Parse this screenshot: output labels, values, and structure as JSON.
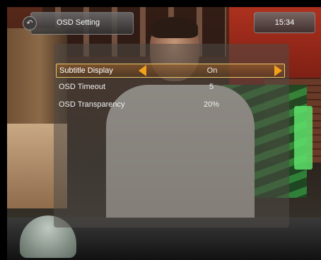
{
  "osd": {
    "title": "OSD Setting",
    "menu_icon": "back-icon",
    "clock": "15:34",
    "items": [
      {
        "label": "Subtitle Display",
        "value": "On",
        "selected": true
      },
      {
        "label": "OSD Timeout",
        "value": "5",
        "selected": false
      },
      {
        "label": "OSD Transparency",
        "value": "20%",
        "selected": false
      }
    ]
  },
  "colors": {
    "selection_arrow": "#f2a21a",
    "selection_border": "#e8c66a"
  }
}
